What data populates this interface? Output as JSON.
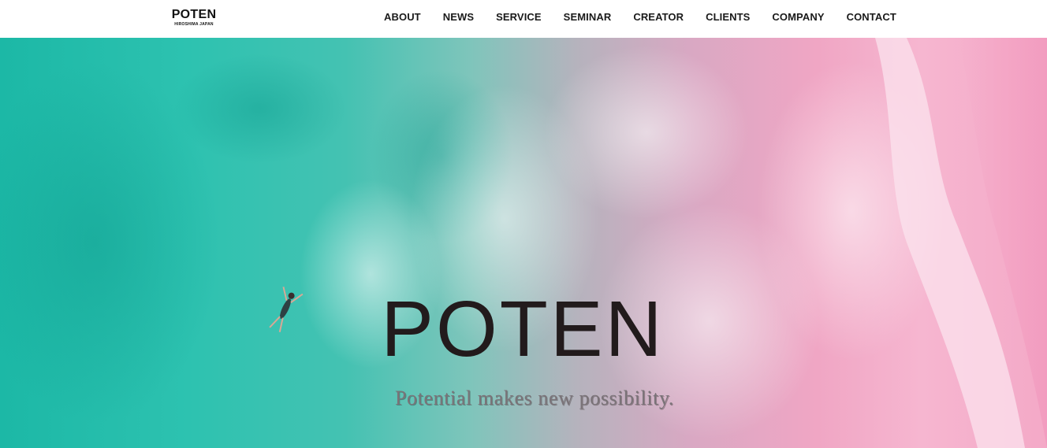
{
  "header": {
    "logo": {
      "main": "POTEN",
      "sub": "HIROSHIMA JAPAN"
    },
    "nav": [
      {
        "label": "ABOUT"
      },
      {
        "label": "NEWS"
      },
      {
        "label": "SERVICE"
      },
      {
        "label": "SEMINAR"
      },
      {
        "label": "CREATOR"
      },
      {
        "label": "CLIENTS"
      },
      {
        "label": "COMPANY"
      },
      {
        "label": "CONTACT"
      }
    ]
  },
  "hero": {
    "title": "POTEN",
    "tagline": "Potential makes new possibility.",
    "image": "aerial-ocean-swimmer-photo"
  },
  "colors": {
    "nav_text": "#1a1a1a",
    "header_bg": "#ffffff",
    "ocean": "#1cb8a6",
    "sand": "#f4a9c7",
    "title": "#221b1c"
  }
}
